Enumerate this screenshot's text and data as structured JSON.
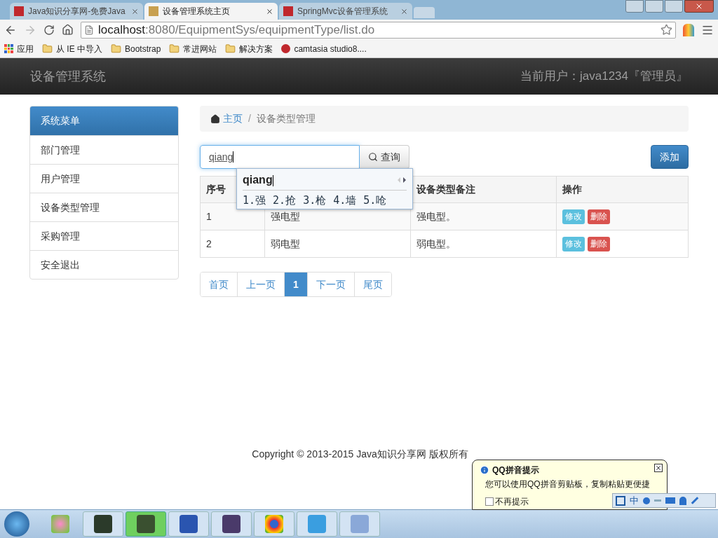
{
  "browser": {
    "tabs": [
      {
        "title": "Java知识分享网-免费Java",
        "selected": false
      },
      {
        "title": "设备管理系统主页",
        "selected": true
      },
      {
        "title": "SpringMvc设备管理系统",
        "selected": false
      }
    ],
    "address": {
      "host": "localhost",
      "rest": ":8080/EquipmentSys/equipmentType/list.do"
    },
    "bookmarks": [
      {
        "kind": "apps",
        "label": "应用"
      },
      {
        "kind": "folder",
        "label": "从 IE 中导入"
      },
      {
        "kind": "folder",
        "label": "Bootstrap"
      },
      {
        "kind": "folder",
        "label": "常进网站"
      },
      {
        "kind": "folder",
        "label": "解决方案"
      },
      {
        "kind": "site",
        "label": "camtasia studio8...."
      }
    ]
  },
  "navbar": {
    "brand": "设备管理系统",
    "user": "当前用户：java1234『管理员』"
  },
  "sidebar": {
    "heading": "系统菜单",
    "items": [
      "部门管理",
      "用户管理",
      "设备类型管理",
      "采购管理",
      "安全退出"
    ]
  },
  "breadcrumb": {
    "home": "主页",
    "separator": "/",
    "current": "设备类型管理"
  },
  "search": {
    "value": "qiang",
    "button": "查询"
  },
  "add_button": "添加",
  "table": {
    "columns": [
      "序号",
      null,
      "设备类型备注",
      "操作"
    ],
    "rows": [
      {
        "cells": [
          "1",
          "强电型",
          "强电型。"
        ],
        "actions": [
          "修改",
          "删除"
        ]
      },
      {
        "cells": [
          "2",
          "弱电型",
          "弱电型。"
        ],
        "actions": [
          "修改",
          "删除"
        ]
      }
    ]
  },
  "pagination": [
    {
      "label": "首页",
      "selected": false
    },
    {
      "label": "上一页",
      "selected": false
    },
    {
      "label": "1",
      "selected": true
    },
    {
      "label": "下一页",
      "selected": false
    },
    {
      "label": "尾页",
      "selected": false
    }
  ],
  "ime": {
    "composition": "qiang",
    "candidates": [
      "1.强",
      "2.抢",
      "3.枪",
      "4.墙",
      "5.呛"
    ]
  },
  "footer": "Copyright © 2013-2015 Java知识分享网 版权所有",
  "tip": {
    "title": "QQ拼音提示",
    "message": "您可以使用QQ拼音剪贴板，复制粘贴更便捷",
    "checkbox": {
      "label": "不再提示",
      "checked": false
    }
  },
  "ime_toolbar": {
    "mode": "中"
  }
}
